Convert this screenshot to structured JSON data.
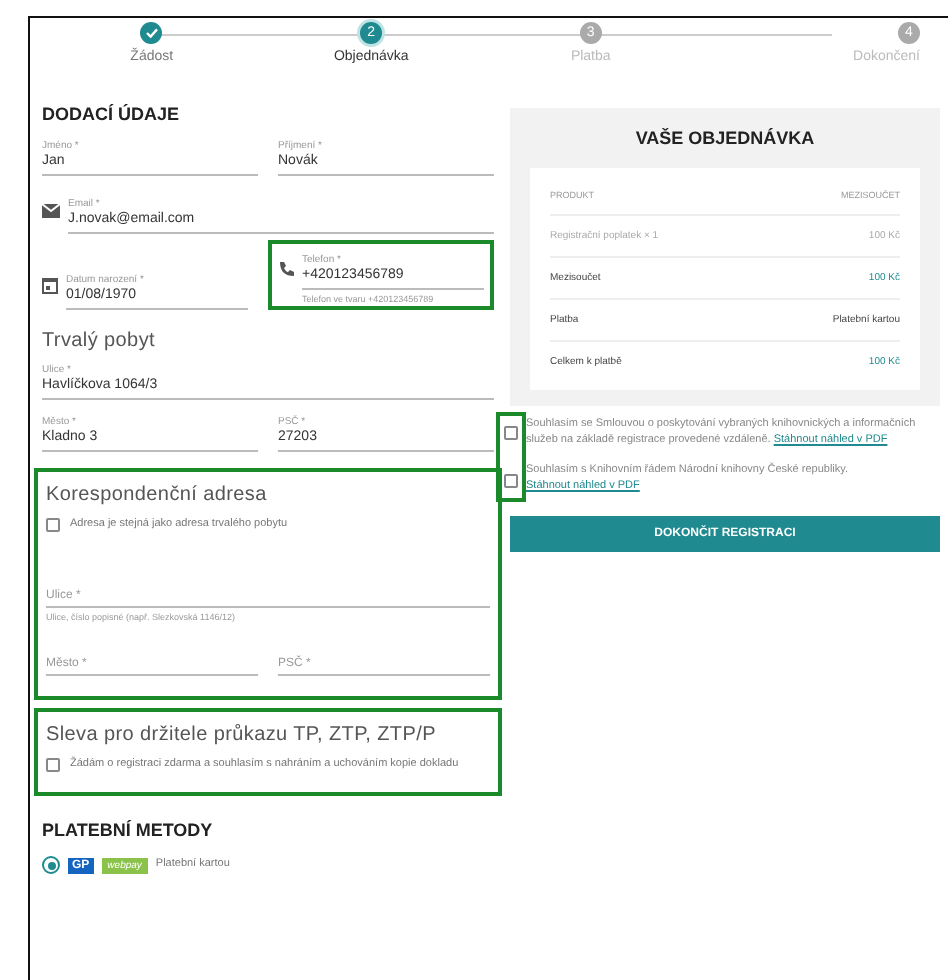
{
  "steps": [
    {
      "label": "Žádost",
      "done": true,
      "selected": false
    },
    {
      "label": "Objednávka",
      "number": "2",
      "done": false,
      "selected": true
    },
    {
      "label": "Platba",
      "number": "3",
      "done": false,
      "selected": false
    },
    {
      "label": "Dokončení",
      "number": "4",
      "done": false,
      "selected": false
    }
  ],
  "delivery": {
    "title": "DODACÍ ÚDAJE",
    "rows": [
      [
        {
          "label": "Jméno *",
          "value": "Jan"
        },
        {
          "label": "Příjmení *",
          "value": "Novák"
        }
      ],
      [
        {
          "label": "Email *",
          "value": "J.novak@email.com",
          "kind": "email"
        }
      ],
      [
        {
          "label": "Datum narození *",
          "value": "01/08/1970",
          "kind": "date"
        },
        {
          "label": "Telefon *",
          "value": "+420123456789",
          "kind": "phone",
          "helper": "Telefon ve tvaru +420123456789",
          "highlighted": true
        }
      ]
    ],
    "residence_title": "Trvalý pobyt",
    "residence_rows": [
      [
        {
          "label": "Ulice *",
          "value": "Havlíčkova 1064/3"
        }
      ],
      [
        {
          "label": "Město *",
          "value": "Kladno 3"
        },
        {
          "label": "PSČ *",
          "value": "27203"
        }
      ]
    ]
  },
  "correspondence": {
    "title": "Korespondenční adresa",
    "highlighted": true,
    "checkbox": {
      "label": "Adresa je stejná jako adresa trvalého pobytu",
      "checked": false
    },
    "rows": [
      [
        {
          "placeholder": "Ulice *",
          "helper": "Ulice, číslo popisné (např. Slezkovská 1146/12)"
        }
      ],
      [
        {
          "placeholder": "Město *"
        },
        {
          "placeholder": "PSČ *"
        }
      ]
    ]
  },
  "discount": {
    "title": "Sleva pro držitele průkazu TP, ZTP, ZTP/P",
    "highlighted": true,
    "checkbox": {
      "label": "Žádám o registraci zdarma a souhlasím s nahráním a uchováním kopie dokladu",
      "checked": false
    }
  },
  "payment": {
    "title": "PLATEBNÍ METODY",
    "options": [
      {
        "logo_left": "GP",
        "logo_right": "webpay",
        "label": "Platební kartou",
        "selected": true
      }
    ]
  },
  "order": {
    "title": "VAŠE OBJEDNÁVKA",
    "columns": [
      "PRODUKT",
      "MEZISOUČET"
    ],
    "rows": [
      {
        "kind": "item",
        "name": "Registrační poplatek × 1",
        "value": "100 Kč"
      },
      {
        "kind": "subtotal",
        "name": "Mezisoučet",
        "value": "100 Kč"
      },
      {
        "kind": "plain",
        "name": "Platba",
        "value": "Platební kartou"
      },
      {
        "kind": "total",
        "name": "Celkem k platbě",
        "value": "100 Kč"
      }
    ]
  },
  "consents": {
    "highlighted": true,
    "items": [
      {
        "text": "Souhlasím se Smlouvou o poskytování vybraných knihovnických a informačních služeb na základě registrace provedené vzdáleně.",
        "link": "Stáhnout náhled v PDF",
        "checked": false
      },
      {
        "text": "Souhlasím s Knihovním řádem Národní knihovny České republiky.",
        "link": "Stáhnout náhled v PDF",
        "checked": false
      }
    ]
  },
  "submit": "DOKONČIT REGISTRACI"
}
